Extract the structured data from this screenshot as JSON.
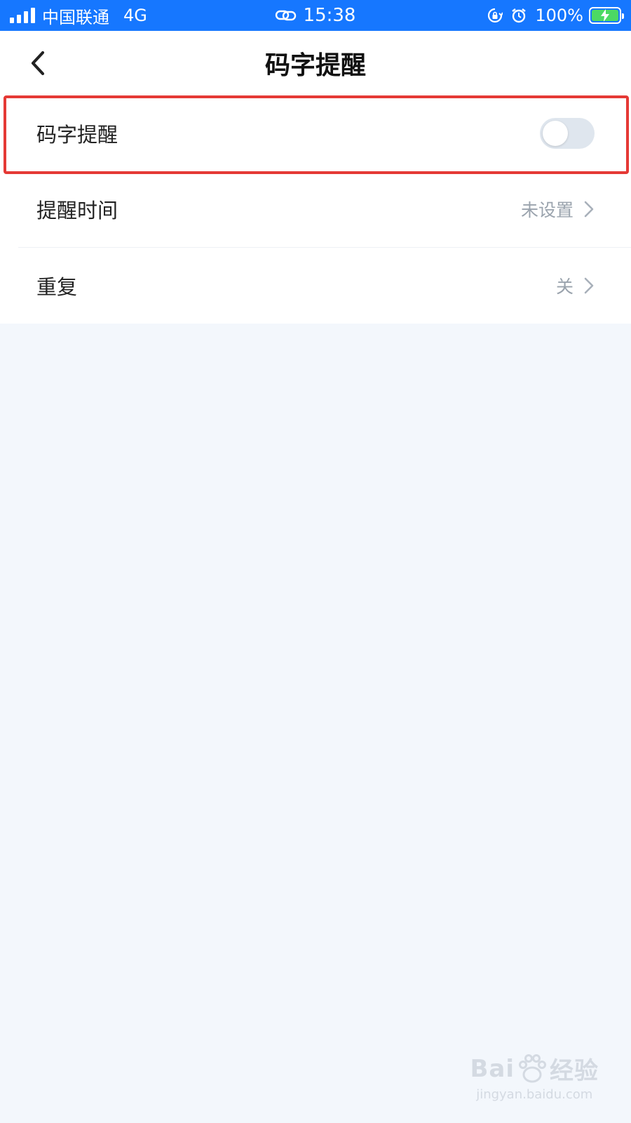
{
  "status_bar": {
    "carrier": "中国联通",
    "network": "4G",
    "time": "15:38",
    "battery": "100%",
    "icons": [
      "signal-icon",
      "link-icon",
      "rotation-lock-icon",
      "alarm-icon",
      "battery-charging-icon"
    ]
  },
  "header": {
    "title": "码字提醒",
    "back_icon": "chevron-left-icon"
  },
  "settings": {
    "reminder_toggle": {
      "label": "码字提醒",
      "on": false
    },
    "reminder_time": {
      "label": "提醒时间",
      "value": "未设置"
    },
    "repeat": {
      "label": "重复",
      "value": "关"
    }
  },
  "watermark": {
    "logo_left": "Bai",
    "logo_right": "经验",
    "url": "jingyan.baidu.com"
  },
  "colors": {
    "status_bar_bg": "#1677ff",
    "highlight_border": "#e53935",
    "page_bg": "#f3f7fc",
    "toggle_off": "#dfe6ee"
  }
}
